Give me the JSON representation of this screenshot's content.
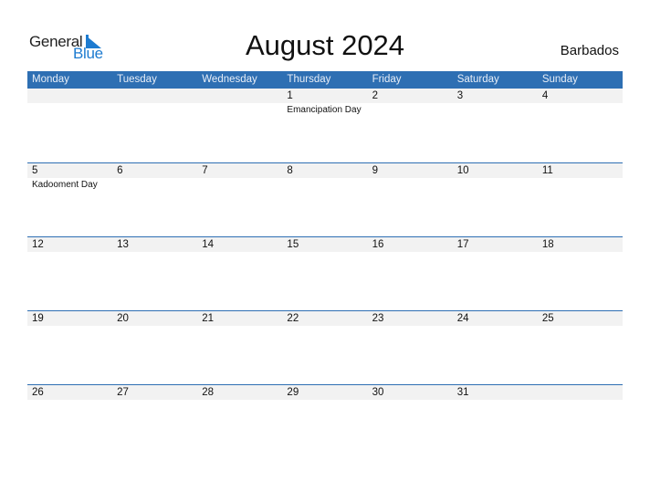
{
  "logo": {
    "part1": "General",
    "part2": "Blue"
  },
  "title": "August 2024",
  "country": "Barbados",
  "weekdays": [
    "Monday",
    "Tuesday",
    "Wednesday",
    "Thursday",
    "Friday",
    "Saturday",
    "Sunday"
  ],
  "weeks": [
    [
      {
        "day": ""
      },
      {
        "day": ""
      },
      {
        "day": ""
      },
      {
        "day": "1",
        "holiday": "Emancipation Day"
      },
      {
        "day": "2"
      },
      {
        "day": "3"
      },
      {
        "day": "4"
      }
    ],
    [
      {
        "day": "5",
        "holiday": "Kadooment Day"
      },
      {
        "day": "6"
      },
      {
        "day": "7"
      },
      {
        "day": "8"
      },
      {
        "day": "9"
      },
      {
        "day": "10"
      },
      {
        "day": "11"
      }
    ],
    [
      {
        "day": "12"
      },
      {
        "day": "13"
      },
      {
        "day": "14"
      },
      {
        "day": "15"
      },
      {
        "day": "16"
      },
      {
        "day": "17"
      },
      {
        "day": "18"
      }
    ],
    [
      {
        "day": "19"
      },
      {
        "day": "20"
      },
      {
        "day": "21"
      },
      {
        "day": "22"
      },
      {
        "day": "23"
      },
      {
        "day": "24"
      },
      {
        "day": "25"
      }
    ],
    [
      {
        "day": "26"
      },
      {
        "day": "27"
      },
      {
        "day": "28"
      },
      {
        "day": "29"
      },
      {
        "day": "30"
      },
      {
        "day": "31"
      },
      {
        "day": ""
      }
    ]
  ],
  "colors": {
    "header_bg": "#2e6fb3",
    "brand_blue": "#1d7bd0",
    "date_band": "#f2f2f2"
  }
}
